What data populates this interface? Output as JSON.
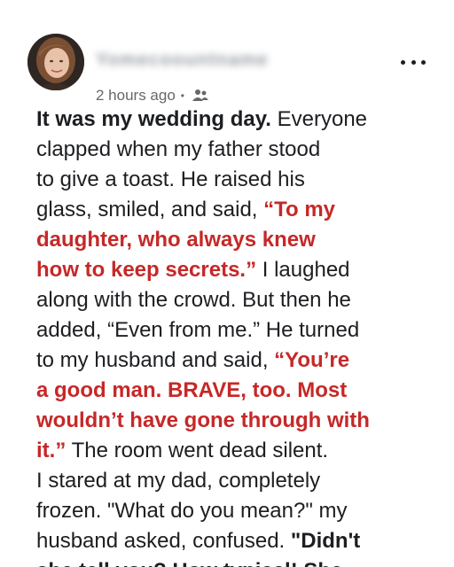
{
  "post": {
    "author_name": "Yomecoountname",
    "timestamp": "2 hours ago",
    "separator": "•",
    "audience_icon": "friends-icon",
    "more_icon": "more-options-icon",
    "lines": [
      [
        {
          "t": "It was my wedding day.",
          "s": "bold"
        },
        {
          "t": " Everyone",
          "s": ""
        }
      ],
      [
        {
          "t": "clapped when my father stood",
          "s": ""
        }
      ],
      [
        {
          "t": "to give a toast. He raised his",
          "s": ""
        }
      ],
      [
        {
          "t": "glass, smiled, and said, ",
          "s": ""
        },
        {
          "t": "“To my",
          "s": "red"
        }
      ],
      [
        {
          "t": "daughter, who always knew",
          "s": "red"
        }
      ],
      [
        {
          "t": "how to keep secrets.”",
          "s": "red"
        },
        {
          "t": " I laughed",
          "s": ""
        }
      ],
      [
        {
          "t": "along with the crowd. But then he",
          "s": ""
        }
      ],
      [
        {
          "t": "added, “Even from me.” He turned",
          "s": ""
        }
      ],
      [
        {
          "t": "to my husband and said, ",
          "s": ""
        },
        {
          "t": "“You’re",
          "s": "red"
        }
      ],
      [
        {
          "t": "a good man. BRAVE, too. Most",
          "s": "red"
        }
      ],
      [
        {
          "t": "wouldn’t have gone through with",
          "s": "red"
        }
      ],
      [
        {
          "t": "it.”",
          "s": "red"
        },
        {
          "t": " The room went dead silent.",
          "s": ""
        }
      ],
      [
        {
          "t": "I stared at my dad, completely",
          "s": ""
        }
      ],
      [
        {
          "t": "frozen. \"What do you mean?\" my",
          "s": ""
        }
      ],
      [
        {
          "t": "husband asked, confused. ",
          "s": ""
        },
        {
          "t": "\"Didn't",
          "s": "bold"
        }
      ],
      [
        {
          "t": "she tell you? How typical! She",
          "s": "bold"
        }
      ]
    ]
  },
  "colors": {
    "text": "#1c1e21",
    "highlight_red": "#c62828",
    "meta_gray": "#65676b"
  }
}
